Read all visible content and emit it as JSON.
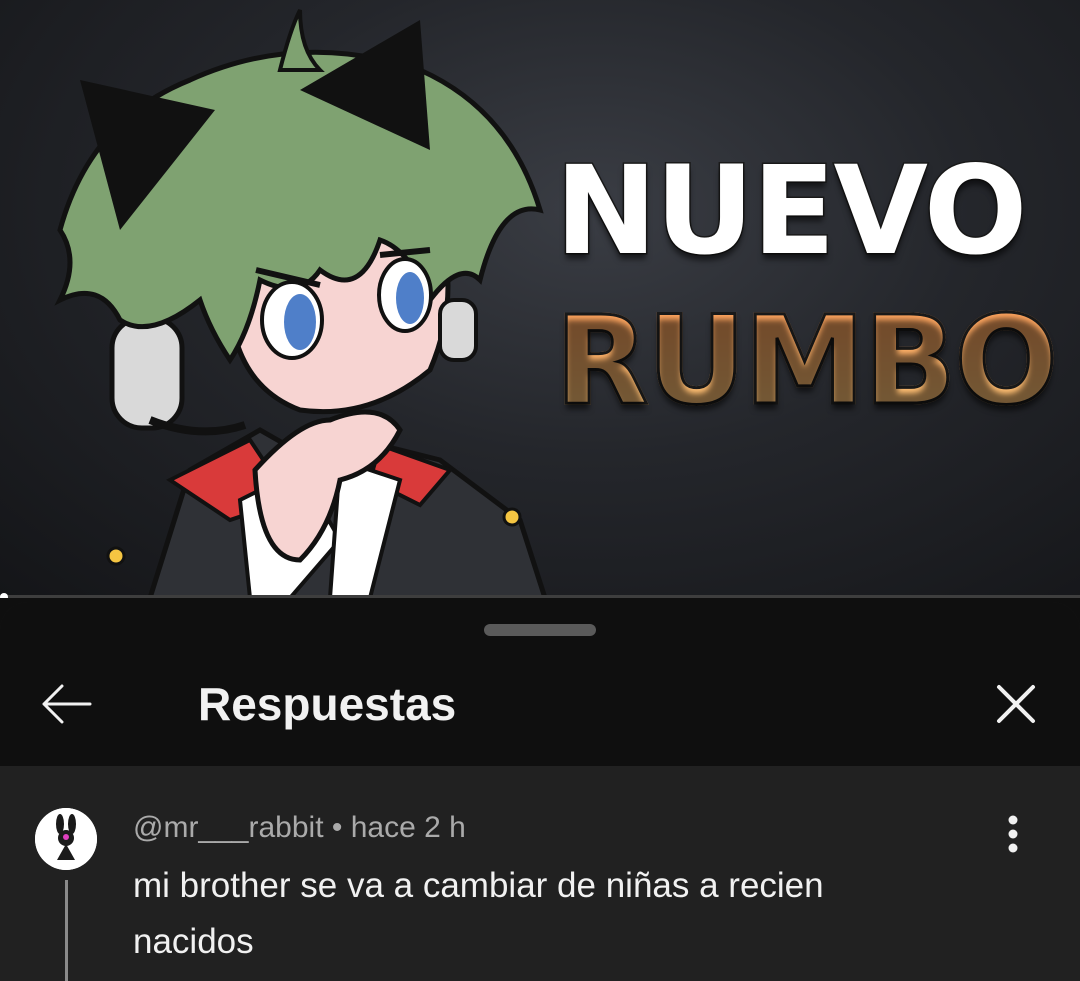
{
  "thumbnail": {
    "title_line1": "NUEVO",
    "title_line2": "RUMBO"
  },
  "player": {
    "progress_fraction": 0.0
  },
  "sheet": {
    "title": "Respuestas"
  },
  "comment": {
    "handle": "@mr___rabbit",
    "separator": " • ",
    "time": "hace 2 h",
    "text": "mi brother se va a cambiar de niñas a recien nacidos"
  },
  "icons": {
    "back": "arrow-left-icon",
    "close": "close-icon",
    "more": "more-vertical-icon"
  },
  "colors": {
    "sheet_header_bg": "#0f0f0f",
    "sheet_body_bg": "#212121",
    "primary_text": "#f1f1f1",
    "secondary_text": "#aaaaaa",
    "title_orange": "#ffb86a"
  }
}
